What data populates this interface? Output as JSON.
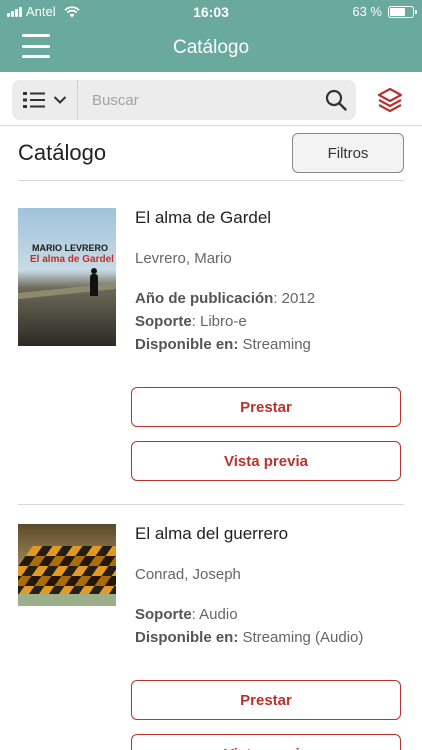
{
  "status_bar": {
    "carrier": "Antel",
    "time": "16:03",
    "battery": "63 %"
  },
  "nav": {
    "title": "Catálogo"
  },
  "search": {
    "placeholder": "Buscar"
  },
  "header": {
    "title": "Catálogo",
    "filters_label": "Filtros"
  },
  "colors": {
    "brand": "#6aa99d",
    "accent": "#b7332f"
  },
  "items": [
    {
      "cover_line1": "MARIO LEVRERO",
      "cover_line2": "El alma de Gardel",
      "title": "El alma de Gardel",
      "author": "Levrero, Mario",
      "year_label": "Año de publicación",
      "year_value": ": 2012",
      "format_label": "Soporte",
      "format_value": ": Libro-e",
      "available_label": "Disponible en:",
      "available_value": " Streaming",
      "borrow_label": "Prestar",
      "preview_label": "Vista previa"
    },
    {
      "title": "El alma del guerrero",
      "author": "Conrad, Joseph",
      "format_label": "Soporte",
      "format_value": ": Audio",
      "available_label": "Disponible en:",
      "available_value": " Streaming (Audio)",
      "borrow_label": "Prestar",
      "preview_label": "Vista previa"
    }
  ]
}
